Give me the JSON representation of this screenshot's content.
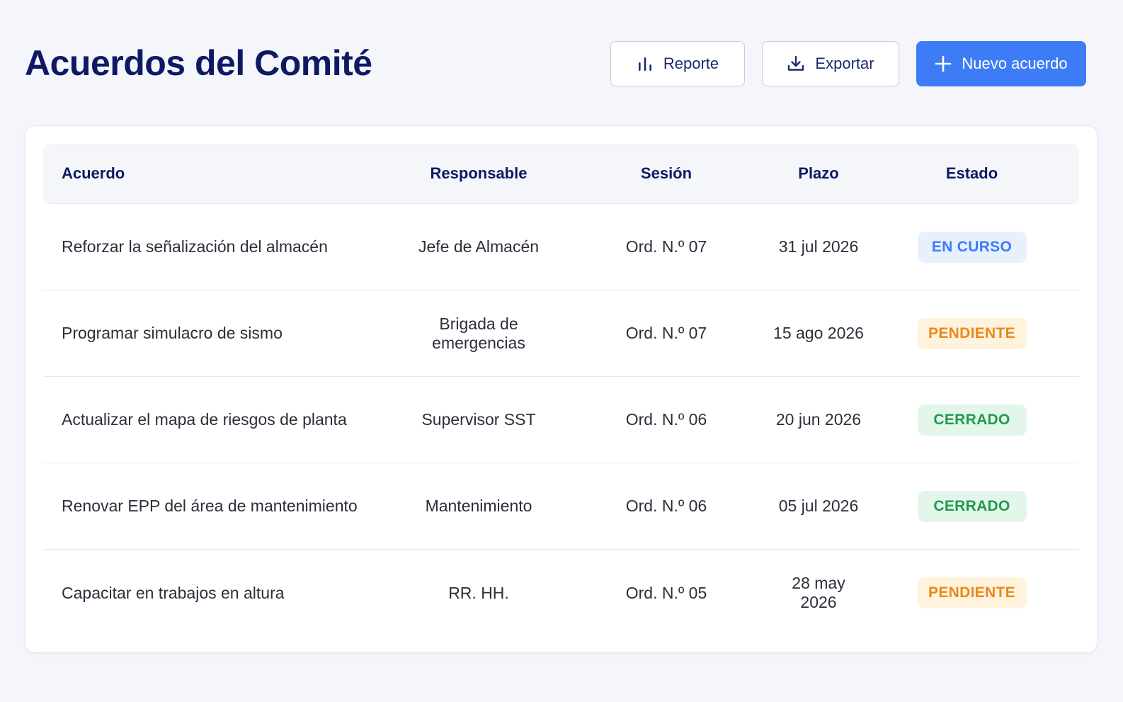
{
  "header": {
    "title": "Acuerdos del Comité"
  },
  "toolbar": {
    "report_label": "Reporte",
    "report_icon": "bar-chart-icon",
    "export_label": "Exportar",
    "export_icon": "download-icon",
    "new_label": "Nuevo acuerdo",
    "new_icon": "plus-icon"
  },
  "colors": {
    "title": "#0d1a63",
    "primary": "#3d7cf5",
    "en_curso_text": "#3d7cf5",
    "en_curso_bg": "#e8f0fe",
    "pendiente_text": "#e8891a",
    "pendiente_bg": "#fff3dd",
    "cerrado_text": "#1f9a4f",
    "cerrado_bg": "#e3f6ea"
  },
  "table": {
    "columns": {
      "acuerdo": "Acuerdo",
      "responsable": "Responsable",
      "sesion": "Sesión",
      "plazo": "Plazo",
      "estado": "Estado"
    },
    "rows": [
      {
        "acuerdo": "Reforzar la señalización del almacén",
        "responsable": "Jefe de Almacén",
        "sesion": "Ord. N.º 07",
        "plazo": "31 jul 2026",
        "estado": "EN CURSO",
        "estado_key": "en_curso"
      },
      {
        "acuerdo": "Programar simulacro de sismo",
        "responsable": "Brigada de emergencias",
        "sesion": "Ord. N.º 07",
        "plazo": "15 ago 2026",
        "estado": "PENDIENTE",
        "estado_key": "pendiente"
      },
      {
        "acuerdo": "Actualizar el mapa de riesgos de planta",
        "responsable": "Supervisor SST",
        "sesion": "Ord. N.º 06",
        "plazo": "20 jun 2026",
        "estado": "CERRADO",
        "estado_key": "cerrado"
      },
      {
        "acuerdo": "Renovar EPP del área de mantenimiento",
        "responsable": "Mantenimiento",
        "sesion": "Ord. N.º 06",
        "plazo": "05 jul 2026",
        "estado": "CERRADO",
        "estado_key": "cerrado"
      },
      {
        "acuerdo": "Capacitar en trabajos en altura",
        "responsable": "RR. HH.",
        "sesion": "Ord. N.º 05",
        "plazo": "28 may 2026",
        "estado": "PENDIENTE",
        "estado_key": "pendiente"
      }
    ]
  }
}
